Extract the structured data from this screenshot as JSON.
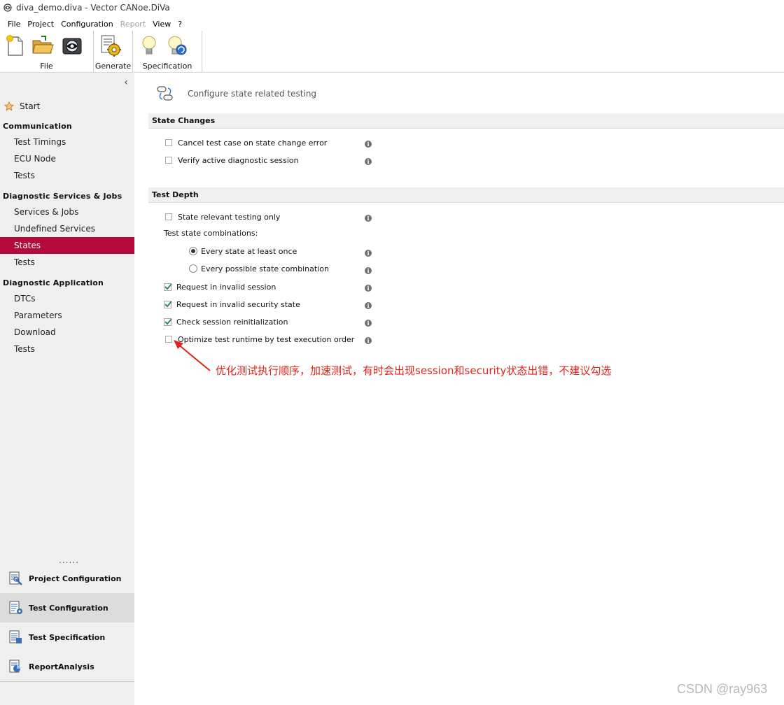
{
  "window": {
    "title": "diva_demo.diva - Vector CANoe.DiVa"
  },
  "menu": {
    "items": [
      {
        "label": "File",
        "enabled": true
      },
      {
        "label": "Project",
        "enabled": true
      },
      {
        "label": "Configuration",
        "enabled": true
      },
      {
        "label": "Report",
        "enabled": false
      },
      {
        "label": "View",
        "enabled": true
      },
      {
        "label": "?",
        "enabled": true
      }
    ]
  },
  "ribbon": {
    "groups": [
      {
        "label": "File",
        "buttons": [
          "new-file-icon",
          "open-folder-icon",
          "save-camera-icon"
        ]
      },
      {
        "label": "Generate",
        "buttons": [
          "generate-gear-icon"
        ]
      },
      {
        "label": "Specification",
        "buttons": [
          "lightbulb-icon",
          "lightbulb-refresh-icon"
        ]
      }
    ]
  },
  "sidebar": {
    "collapse_glyph": "‹",
    "start_label": "Start",
    "sections": [
      {
        "header": "Communication",
        "items": [
          "Test Timings",
          "ECU Node",
          "Tests"
        ]
      },
      {
        "header": "Diagnostic  Services  &  Jobs",
        "items": [
          "Services & Jobs",
          "Undefined Services",
          "States",
          "Tests"
        ]
      },
      {
        "header": "Diagnostic  Application",
        "items": [
          "DTCs",
          "Parameters",
          "Download",
          "Tests"
        ]
      }
    ],
    "active_item": "States",
    "more_dots": "......",
    "bottom_nav": [
      {
        "label": "Project Configuration",
        "selected": false
      },
      {
        "label": "Test Configuration",
        "selected": true
      },
      {
        "label": "Test Specification",
        "selected": false
      },
      {
        "label": "ReportAnalysis",
        "selected": false
      }
    ]
  },
  "main": {
    "header_text": "Configure state related testing",
    "state_changes": {
      "title": "State Changes",
      "options": [
        {
          "label": "Cancel test case on state change error",
          "checked": false
        },
        {
          "label": "Verify active diagnostic session",
          "checked": false
        }
      ]
    },
    "test_depth": {
      "title": "Test Depth",
      "state_relevant": {
        "label": "State relevant testing only",
        "checked": false
      },
      "combinations_label": "Test state combinations:",
      "radios": [
        {
          "label": "Every state at least once",
          "selected": true
        },
        {
          "label": "Every possible state combination",
          "selected": false
        }
      ],
      "options": [
        {
          "label": "Request in invalid session",
          "checked": true
        },
        {
          "label": "Request in invalid security state",
          "checked": true
        },
        {
          "label": "Check session reinitialization",
          "checked": true
        },
        {
          "label": "Optimize test runtime by test execution order",
          "checked": false
        }
      ]
    },
    "info_glyph": "i"
  },
  "annotation": {
    "text": "优化测试执行顺序，加速测试，有时会出现session和security状态出错，不建议勾选",
    "color": "#e0241b"
  },
  "watermark": "CSDN @ray963",
  "colors": {
    "active_nav": "#b5093b",
    "check_green": "#2e8b57"
  }
}
